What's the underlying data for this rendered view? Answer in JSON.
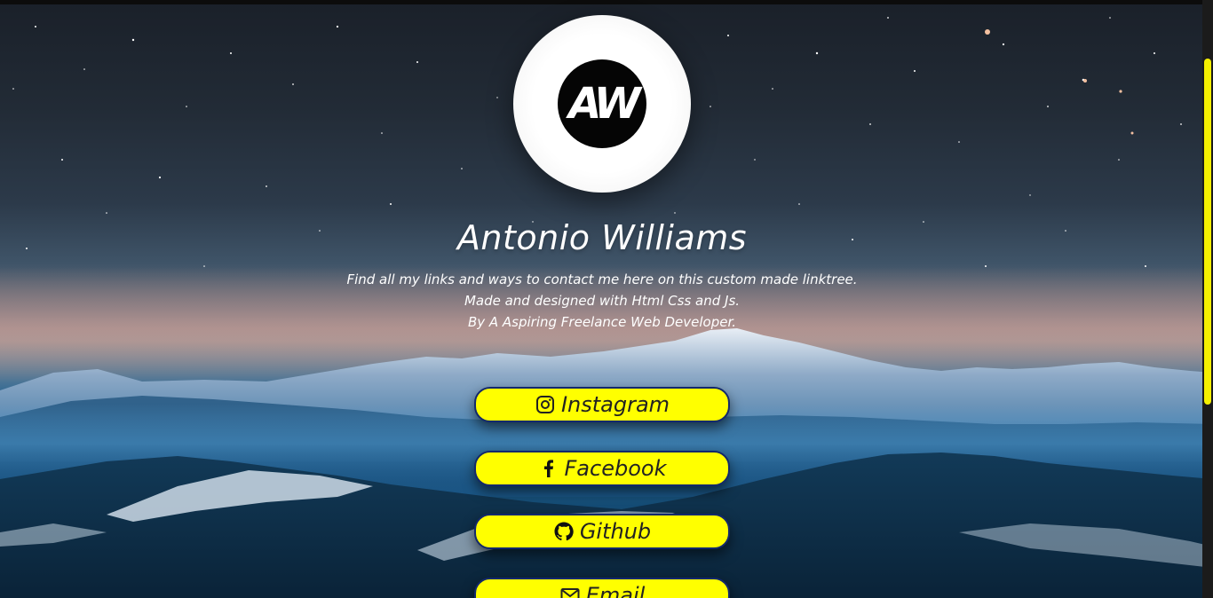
{
  "colors": {
    "accent": "#ffff00",
    "button_border": "#13296b",
    "text": "#ffffff",
    "scroll_thumb": "#f5f000"
  },
  "profile": {
    "avatar_logo_text": "AW",
    "name": "Antonio Williams",
    "bio": [
      "Find all my links and ways to contact me here on this custom made linktree.",
      "Made and designed with Html Css and Js.",
      "By A Aspiring Freelance Web Developer."
    ]
  },
  "links": [
    {
      "label": "Instagram",
      "icon": "instagram-icon"
    },
    {
      "label": "Facebook",
      "icon": "facebook-icon"
    },
    {
      "label": "Github",
      "icon": "github-icon"
    },
    {
      "label": "Email",
      "icon": "email-icon"
    }
  ]
}
